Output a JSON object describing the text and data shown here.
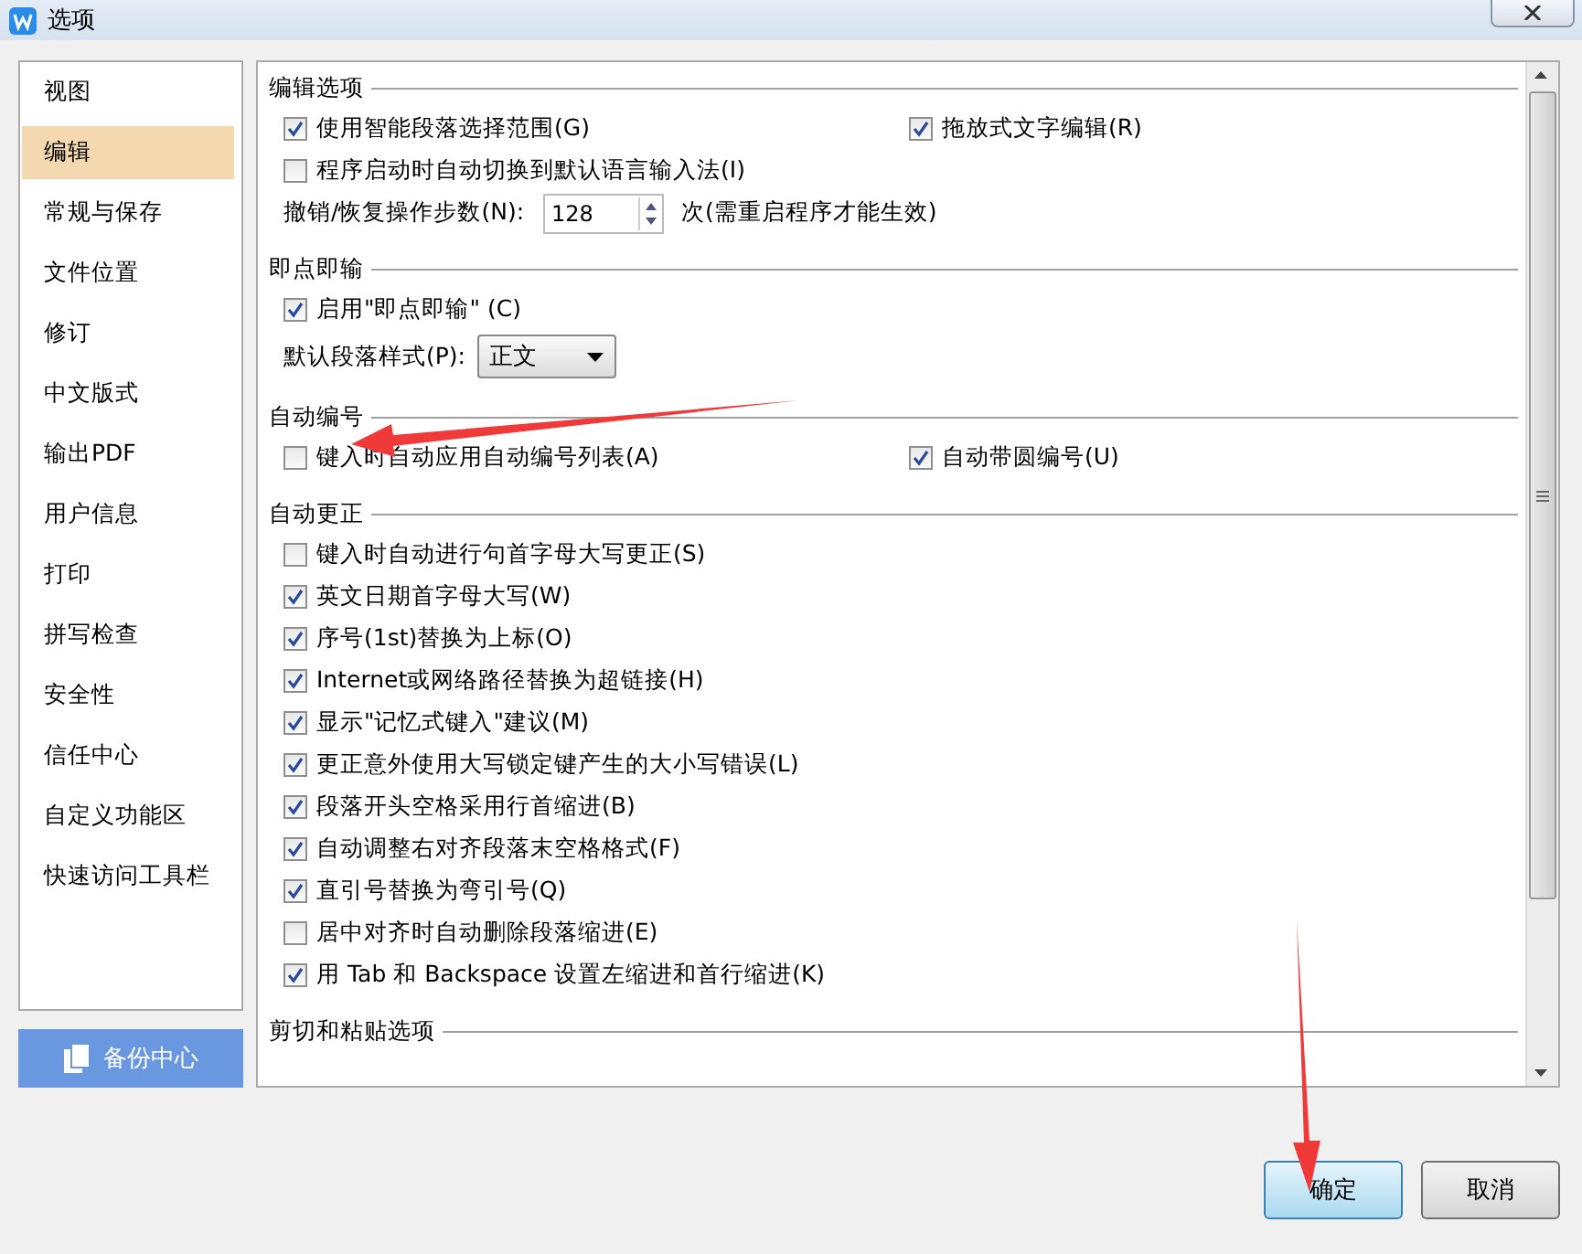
{
  "window": {
    "title": "选项"
  },
  "sidebar": {
    "items": [
      {
        "label": "视图",
        "selected": false
      },
      {
        "label": "编辑",
        "selected": true
      },
      {
        "label": "常规与保存",
        "selected": false
      },
      {
        "label": "文件位置",
        "selected": false
      },
      {
        "label": "修订",
        "selected": false
      },
      {
        "label": "中文版式",
        "selected": false
      },
      {
        "label": "输出PDF",
        "selected": false
      },
      {
        "label": "用户信息",
        "selected": false
      },
      {
        "label": "打印",
        "selected": false
      },
      {
        "label": "拼写检查",
        "selected": false
      },
      {
        "label": "安全性",
        "selected": false
      },
      {
        "label": "信任中心",
        "selected": false
      },
      {
        "label": "自定义功能区",
        "selected": false
      },
      {
        "label": "快速访问工具栏",
        "selected": false
      }
    ],
    "backup_button": "备份中心"
  },
  "sections": [
    {
      "title": "编辑选项",
      "rows": [
        {
          "controls": [
            {
              "kind": "checkbox",
              "label": "使用智能段落选择范围(G)",
              "checked": true
            },
            {
              "kind": "checkbox",
              "label": "拖放式文字编辑(R)",
              "checked": true
            }
          ]
        },
        {
          "controls": [
            {
              "kind": "checkbox",
              "label": "程序启动时自动切换到默认语言输入法(I)",
              "checked": false
            }
          ]
        },
        {
          "controls": [
            {
              "kind": "label",
              "text": "撤销/恢复操作步数(N):"
            },
            {
              "kind": "spinner",
              "value": "128"
            },
            {
              "kind": "label",
              "text": "次(需重启程序才能生效)"
            }
          ]
        }
      ]
    },
    {
      "title": "即点即输",
      "rows": [
        {
          "controls": [
            {
              "kind": "checkbox",
              "label": "启用\"即点即输\" (C)",
              "checked": true
            }
          ]
        },
        {
          "controls": [
            {
              "kind": "label",
              "text": "默认段落样式(P):"
            },
            {
              "kind": "dropdown",
              "value": "正文"
            }
          ]
        }
      ]
    },
    {
      "title": "自动编号",
      "rows": [
        {
          "controls": [
            {
              "kind": "checkbox",
              "label": "键入时自动应用自动编号列表(A)",
              "checked": false
            },
            {
              "kind": "checkbox",
              "label": "自动带圆编号(U)",
              "checked": true
            }
          ]
        }
      ]
    },
    {
      "title": "自动更正",
      "rows": [
        {
          "controls": [
            {
              "kind": "checkbox",
              "label": "键入时自动进行句首字母大写更正(S)",
              "checked": false
            }
          ]
        },
        {
          "controls": [
            {
              "kind": "checkbox",
              "label": "英文日期首字母大写(W)",
              "checked": true
            }
          ]
        },
        {
          "controls": [
            {
              "kind": "checkbox",
              "label": "序号(1st)替换为上标(O)",
              "checked": true
            }
          ]
        },
        {
          "controls": [
            {
              "kind": "checkbox",
              "label": "Internet或网络路径替换为超链接(H)",
              "checked": true
            }
          ]
        },
        {
          "controls": [
            {
              "kind": "checkbox",
              "label": "显示\"记忆式键入\"建议(M)",
              "checked": true
            }
          ]
        },
        {
          "controls": [
            {
              "kind": "checkbox",
              "label": "更正意外使用大写锁定键产生的大小写错误(L)",
              "checked": true
            }
          ]
        },
        {
          "controls": [
            {
              "kind": "checkbox",
              "label": "段落开头空格采用行首缩进(B)",
              "checked": true
            }
          ]
        },
        {
          "controls": [
            {
              "kind": "checkbox",
              "label": "自动调整右对齐段落末空格格式(F)",
              "checked": true
            }
          ]
        },
        {
          "controls": [
            {
              "kind": "checkbox",
              "label": "直引号替换为弯引号(Q)",
              "checked": true
            }
          ]
        },
        {
          "controls": [
            {
              "kind": "checkbox",
              "label": "居中对齐时自动删除段落缩进(E)",
              "checked": false
            }
          ]
        },
        {
          "controls": [
            {
              "kind": "checkbox",
              "label": "用 Tab 和 Backspace 设置左缩进和首行缩进(K)",
              "checked": true
            }
          ]
        }
      ]
    },
    {
      "title": "剪切和粘贴选项"
    }
  ],
  "buttons": [
    {
      "label": "确定",
      "selected": true
    },
    {
      "label": "取消",
      "selected": false
    }
  ]
}
